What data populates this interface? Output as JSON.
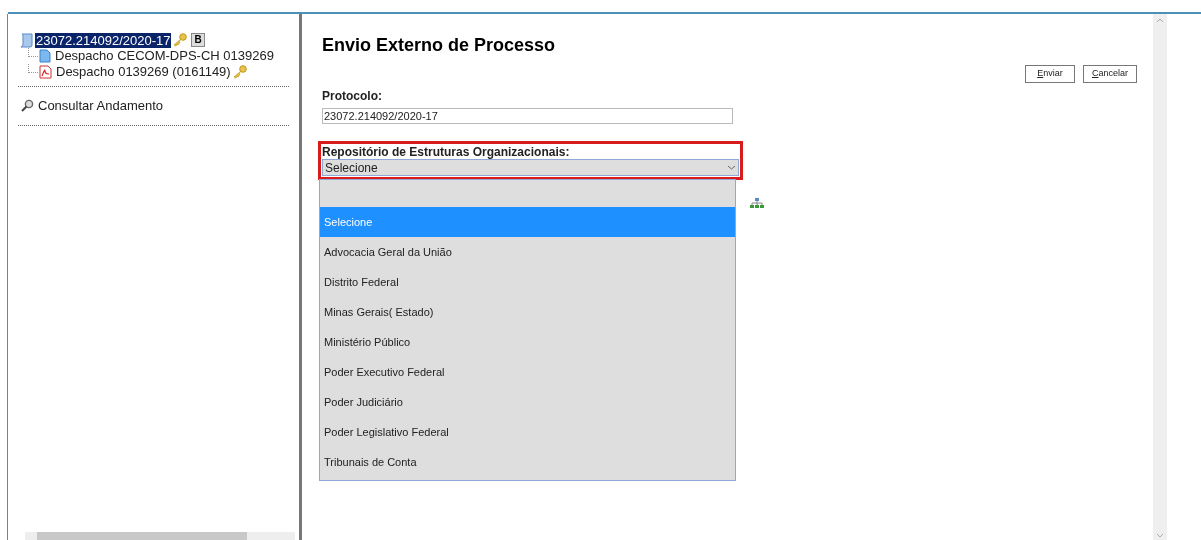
{
  "tree": {
    "root": {
      "label": "23072.214092/2020-17",
      "selected": true,
      "badge": "B"
    },
    "children": [
      {
        "kind": "doc",
        "label": "Despacho CECOM-DPS-CH 0139269",
        "key": false
      },
      {
        "kind": "pdf",
        "label": "Despacho 0139269 (0161149)",
        "key": true
      }
    ]
  },
  "menu": [
    {
      "label": "Consultar Andamento"
    }
  ],
  "form": {
    "title": "Envio Externo de Processo",
    "buttons": [
      {
        "label": "Enviar"
      },
      {
        "label": "Cancelar"
      }
    ],
    "protocolo": {
      "label": "Protocolo:",
      "value": "23072.214092/2020-17"
    },
    "repositorio": {
      "label": "Repositório de Estruturas Organizacionais:",
      "value": "Selecione",
      "expanded": true,
      "options": [
        {
          "label": "Selecione",
          "selected": true
        },
        {
          "label": "Advocacia Geral da União",
          "selected": false
        },
        {
          "label": "Distrito Federal",
          "selected": false
        },
        {
          "label": "Minas Gerais( Estado)",
          "selected": false
        },
        {
          "label": "Ministério Público",
          "selected": false
        },
        {
          "label": "Poder Executivo Federal",
          "selected": false
        },
        {
          "label": "Poder Judiciário",
          "selected": false
        },
        {
          "label": "Poder Legislativo Federal",
          "selected": false
        },
        {
          "label": "Tribunais de Conta",
          "selected": false
        }
      ]
    }
  }
}
